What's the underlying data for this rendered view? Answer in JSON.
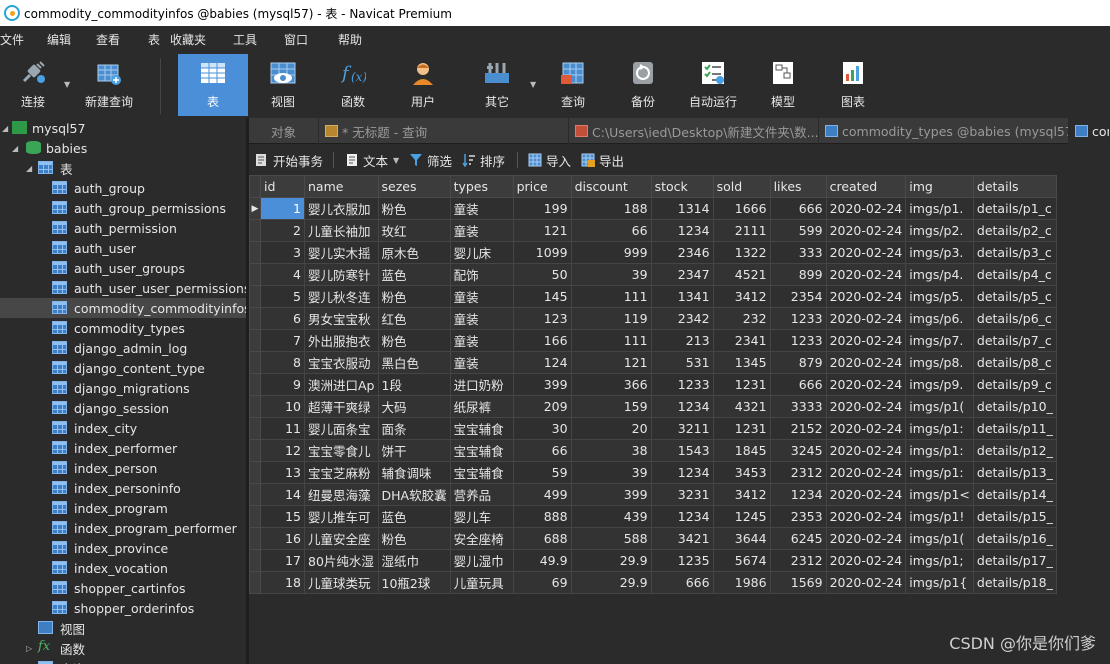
{
  "window": {
    "title": "commodity_commodityinfos @babies (mysql57) - 表 - Navicat Premium"
  },
  "menu": [
    "文件",
    "编辑",
    "查看",
    "表",
    "收藏夹",
    "工具",
    "窗口",
    "帮助"
  ],
  "toolbar": {
    "buttons": [
      {
        "label": "连接",
        "icon": "plug-icon"
      },
      {
        "label": "新建查询",
        "icon": "new-query-icon"
      },
      {
        "label": "表",
        "icon": "table-icon"
      },
      {
        "label": "视图",
        "icon": "view-icon"
      },
      {
        "label": "函数",
        "icon": "function-icon"
      },
      {
        "label": "用户",
        "icon": "user-icon"
      },
      {
        "label": "其它",
        "icon": "tools-icon"
      },
      {
        "label": "查询",
        "icon": "query-icon"
      },
      {
        "label": "备份",
        "icon": "backup-icon"
      },
      {
        "label": "自动运行",
        "icon": "checklist-icon"
      },
      {
        "label": "模型",
        "icon": "model-icon"
      },
      {
        "label": "图表",
        "icon": "chart-icon"
      }
    ],
    "active": "表"
  },
  "sidebar": {
    "connection": "mysql57",
    "database": "babies",
    "tables_group": "表",
    "tables": [
      "auth_group",
      "auth_group_permissions",
      "auth_permission",
      "auth_user",
      "auth_user_groups",
      "auth_user_user_permissions",
      "commodity_commodityinfos",
      "commodity_types",
      "django_admin_log",
      "django_content_type",
      "django_migrations",
      "django_session",
      "index_city",
      "index_performer",
      "index_person",
      "index_personinfo",
      "index_program",
      "index_program_performer",
      "index_province",
      "index_vocation",
      "shopper_cartinfos",
      "shopper_orderinfos"
    ],
    "selected": "commodity_commodityinfos",
    "views_group": "视图",
    "functions_group": "函数",
    "queries_group": "查询"
  },
  "tabs": [
    {
      "label": "对象",
      "icon": ""
    },
    {
      "label": "* 无标题 - 查询",
      "icon": "q"
    },
    {
      "label": "C:\\Users\\ied\\Desktop\\新建文件夹\\数...",
      "icon": "f"
    },
    {
      "label": "commodity_types @babies (mysql57...",
      "icon": "t"
    },
    {
      "label": "con",
      "icon": "t"
    }
  ],
  "subtoolbar": {
    "begin_tx": "开始事务",
    "text": "文本",
    "filter": "筛选",
    "sort": "排序",
    "import": "导入",
    "export": "导出"
  },
  "grid": {
    "columns": [
      "id",
      "name",
      "sezes",
      "types",
      "price",
      "discount",
      "stock",
      "sold",
      "likes",
      "created",
      "img",
      "details"
    ],
    "rows": [
      [
        "1",
        "婴儿衣服加",
        "粉色",
        "童装",
        "199",
        "188",
        "1314",
        "1666",
        "666",
        "2020-02-24",
        "imgs/p1.",
        "details/p1_c"
      ],
      [
        "2",
        "儿童长袖加",
        "玫红",
        "童装",
        "121",
        "66",
        "1234",
        "2111",
        "599",
        "2020-02-24",
        "imgs/p2.",
        "details/p2_c"
      ],
      [
        "3",
        "婴儿实木摇",
        "原木色",
        "婴儿床",
        "1099",
        "999",
        "2346",
        "1322",
        "333",
        "2020-02-24",
        "imgs/p3.",
        "details/p3_c"
      ],
      [
        "4",
        "婴儿防寒针",
        "蓝色",
        "配饰",
        "50",
        "39",
        "2347",
        "4521",
        "899",
        "2020-02-24",
        "imgs/p4.",
        "details/p4_c"
      ],
      [
        "5",
        "婴儿秋冬连",
        "粉色",
        "童装",
        "145",
        "111",
        "1341",
        "3412",
        "2354",
        "2020-02-24",
        "imgs/p5.",
        "details/p5_c"
      ],
      [
        "6",
        "男女宝宝秋",
        "红色",
        "童装",
        "123",
        "119",
        "2342",
        "232",
        "1233",
        "2020-02-24",
        "imgs/p6.",
        "details/p6_c"
      ],
      [
        "7",
        "外出服抱衣",
        "粉色",
        "童装",
        "166",
        "111",
        "213",
        "2341",
        "1233",
        "2020-02-24",
        "imgs/p7.",
        "details/p7_c"
      ],
      [
        "8",
        "宝宝衣服动",
        "黑白色",
        "童装",
        "124",
        "121",
        "531",
        "1345",
        "879",
        "2020-02-24",
        "imgs/p8.",
        "details/p8_c"
      ],
      [
        "9",
        "澳洲进口Ap",
        "1段",
        "进口奶粉",
        "399",
        "366",
        "1233",
        "1231",
        "666",
        "2020-02-24",
        "imgs/p9.",
        "details/p9_c"
      ],
      [
        "10",
        "超薄干爽绿",
        "大码",
        "纸尿裤",
        "209",
        "159",
        "1234",
        "4321",
        "3333",
        "2020-02-24",
        "imgs/p1(",
        "details/p10_"
      ],
      [
        "11",
        "婴儿面条宝",
        "面条",
        "宝宝辅食",
        "30",
        "20",
        "3211",
        "1231",
        "2152",
        "2020-02-24",
        "imgs/p1:",
        "details/p11_"
      ],
      [
        "12",
        "宝宝零食儿",
        "饼干",
        "宝宝辅食",
        "66",
        "38",
        "1543",
        "1845",
        "3245",
        "2020-02-24",
        "imgs/p1:",
        "details/p12_"
      ],
      [
        "13",
        "宝宝芝麻粉",
        "辅食调味",
        "宝宝辅食",
        "59",
        "39",
        "1234",
        "3453",
        "2312",
        "2020-02-24",
        "imgs/p1:",
        "details/p13_"
      ],
      [
        "14",
        "纽曼思海藻",
        "DHA软胶囊",
        "营养品",
        "499",
        "399",
        "3231",
        "3412",
        "1234",
        "2020-02-24",
        "imgs/p1<",
        "details/p14_"
      ],
      [
        "15",
        "婴儿推车可",
        "蓝色",
        "婴儿车",
        "888",
        "439",
        "1234",
        "1245",
        "2353",
        "2020-02-24",
        "imgs/p1!",
        "details/p15_"
      ],
      [
        "16",
        "儿童安全座",
        "粉色",
        "安全座椅",
        "688",
        "588",
        "3421",
        "3644",
        "6245",
        "2020-02-24",
        "imgs/p1(",
        "details/p16_"
      ],
      [
        "17",
        "80片纯水湿",
        "湿纸巾",
        "婴儿湿巾",
        "49.9",
        "29.9",
        "1235",
        "5674",
        "2312",
        "2020-02-24",
        "imgs/p1;",
        "details/p17_"
      ],
      [
        "18",
        "儿童球类玩",
        "10瓶2球",
        "儿童玩具",
        "69",
        "29.9",
        "666",
        "1986",
        "1569",
        "2020-02-24",
        "imgs/p1{",
        "details/p18_"
      ]
    ],
    "current_row": 0
  },
  "watermark": "CSDN @你是你们爹"
}
